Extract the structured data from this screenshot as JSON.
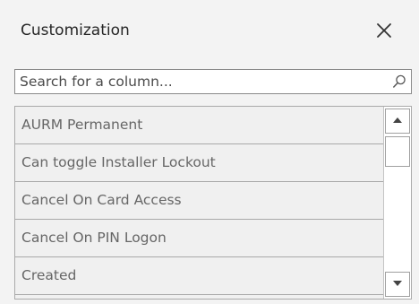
{
  "panel": {
    "title": "Customization",
    "close_icon": "close-icon"
  },
  "search": {
    "placeholder": "Search for a column...",
    "value": "",
    "icon": "search-icon"
  },
  "columns": {
    "items": [
      {
        "label": "AURM Permanent"
      },
      {
        "label": "Can toggle Installer Lockout"
      },
      {
        "label": "Cancel On Card Access"
      },
      {
        "label": "Cancel On PIN Logon"
      },
      {
        "label": "Created"
      }
    ]
  },
  "scrollbar": {
    "up_icon": "triangle-up-icon",
    "down_icon": "triangle-down-icon"
  },
  "colors": {
    "panel_background": "#f3f3f3",
    "list_background": "#f0f0f0",
    "item_text": "#666666",
    "title_text": "#262626",
    "divider": "#a9a9a9"
  }
}
